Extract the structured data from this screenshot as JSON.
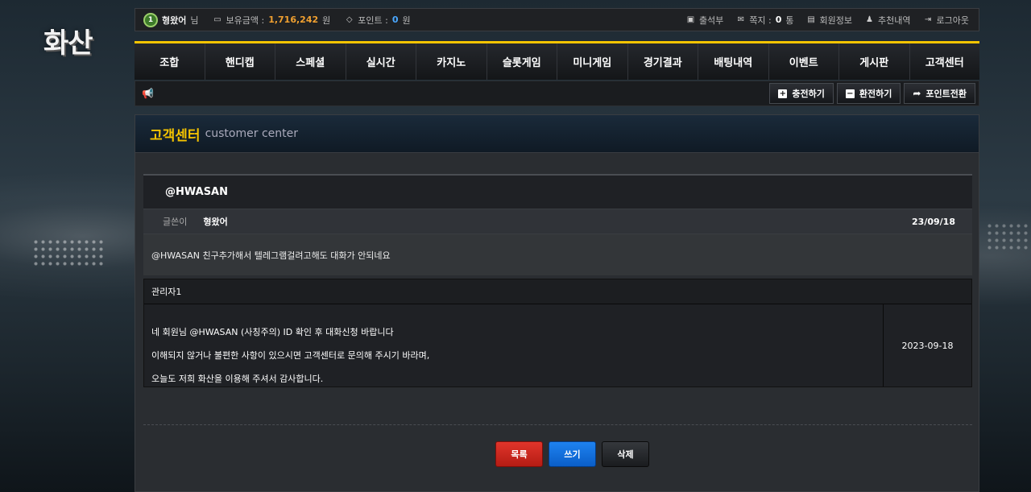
{
  "site": {
    "logo": "화산"
  },
  "topbar": {
    "level_badge": "1",
    "user_name": "형왔어",
    "user_suffix": "님",
    "money_label": "보유금액 : ",
    "money_value": "1,716,242",
    "money_unit": "원",
    "point_label": "포인트 : ",
    "point_value": "0",
    "point_unit": "원",
    "attendance": "출석부",
    "message_label": "쪽지 : ",
    "message_count": "0",
    "message_unit": " 통",
    "member_info": "회원정보",
    "recommend": "추천내역",
    "logout": "로그아웃"
  },
  "nav": {
    "items": [
      "조합",
      "핸디캡",
      "스페셜",
      "실시간",
      "카지노",
      "슬롯게임",
      "미니게임",
      "경기결과",
      "배팅내역",
      "이벤트",
      "게시판",
      "고객센터"
    ]
  },
  "subbar": {
    "charge": "충전하기",
    "exchange": "환전하기",
    "point_convert": "포인트전환"
  },
  "panel": {
    "title": "고객센터",
    "subtitle": "customer center"
  },
  "post": {
    "title": "@HWASAN",
    "writer_label": "글쓴이",
    "writer": "형왔어",
    "date": "23/09/18",
    "body": "@HWASAN 친구추가해서 텔레그램걸려고해도 대화가 안되네요"
  },
  "reply": {
    "author": "관리자1",
    "lines": [
      "네 회원님 @HWASAN (사칭주의) ID 확인 후 대화신청 바랍니다",
      "이해되지 않거나 불편한 사항이 있으시면 고객센터로 문의해 주시기 바라며,",
      "오늘도 저희 화산을 이용해 주셔서 감사합니다."
    ],
    "date": "2023-09-18"
  },
  "buttons": {
    "list": "목록",
    "write": "쓰기",
    "delete": "삭제"
  }
}
